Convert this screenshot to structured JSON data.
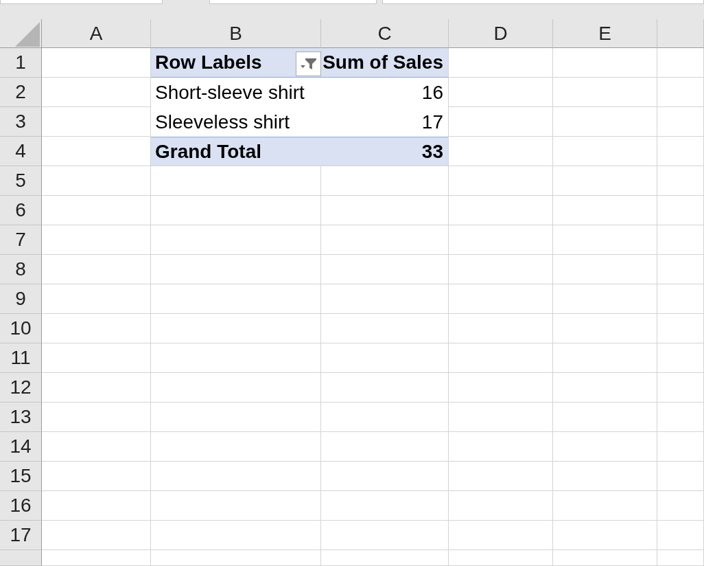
{
  "columns": [
    "A",
    "B",
    "C",
    "D",
    "E"
  ],
  "row_numbers": [
    "1",
    "2",
    "3",
    "4",
    "5",
    "6",
    "7",
    "8",
    "9",
    "10",
    "11",
    "12",
    "13",
    "14",
    "15",
    "16",
    "17"
  ],
  "pivot_table": {
    "header": {
      "row_label": "Row Labels",
      "value_label": "Sum of Sales"
    },
    "items": [
      {
        "label": "Short-sleeve shirt",
        "value": "16"
      },
      {
        "label": "Sleeveless shirt",
        "value": "17"
      }
    ],
    "total": {
      "label": "Grand Total",
      "value": "33"
    }
  }
}
